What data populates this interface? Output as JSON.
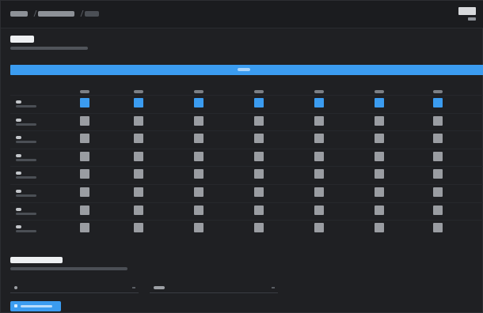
{
  "theme": {
    "background": "#1f2023",
    "surface": "#1b1c1f",
    "accent": "#3b9cf0",
    "toggle_off": "#9a9da2",
    "text_primary": "#eef0f2"
  },
  "header": {
    "breadcrumb": [
      "",
      "",
      ""
    ],
    "brand": "",
    "brand_sub": ""
  },
  "routing": {
    "title": "",
    "subtitle": "",
    "master_toggle_label": "",
    "master_toggle_on": true
  },
  "matrix": {
    "columns": [
      {
        "label": ""
      },
      {
        "label": ""
      },
      {
        "label": ""
      },
      {
        "label": ""
      },
      {
        "label": ""
      },
      {
        "label": ""
      },
      {
        "label": ""
      }
    ],
    "rows": [
      {
        "name": "",
        "sub": "",
        "states": [
          true,
          true,
          true,
          true,
          true,
          true,
          true
        ]
      },
      {
        "name": "",
        "sub": "",
        "states": [
          false,
          false,
          false,
          false,
          false,
          false,
          false
        ]
      },
      {
        "name": "",
        "sub": "",
        "states": [
          false,
          false,
          false,
          false,
          false,
          false,
          false
        ]
      },
      {
        "name": "",
        "sub": "",
        "states": [
          false,
          false,
          false,
          false,
          false,
          false,
          false
        ]
      },
      {
        "name": "",
        "sub": "",
        "states": [
          false,
          false,
          false,
          false,
          false,
          false,
          false
        ]
      },
      {
        "name": "",
        "sub": "",
        "states": [
          false,
          false,
          false,
          false,
          false,
          false,
          false
        ]
      },
      {
        "name": "",
        "sub": "",
        "states": [
          false,
          false,
          false,
          false,
          false,
          false,
          false
        ]
      },
      {
        "name": "",
        "sub": "",
        "states": [
          false,
          false,
          false,
          false,
          false,
          false,
          false
        ]
      }
    ]
  },
  "presets": {
    "title": "",
    "subtitle": "",
    "preset_select_value": "",
    "preset_name_value": "",
    "save_button_label": ""
  }
}
